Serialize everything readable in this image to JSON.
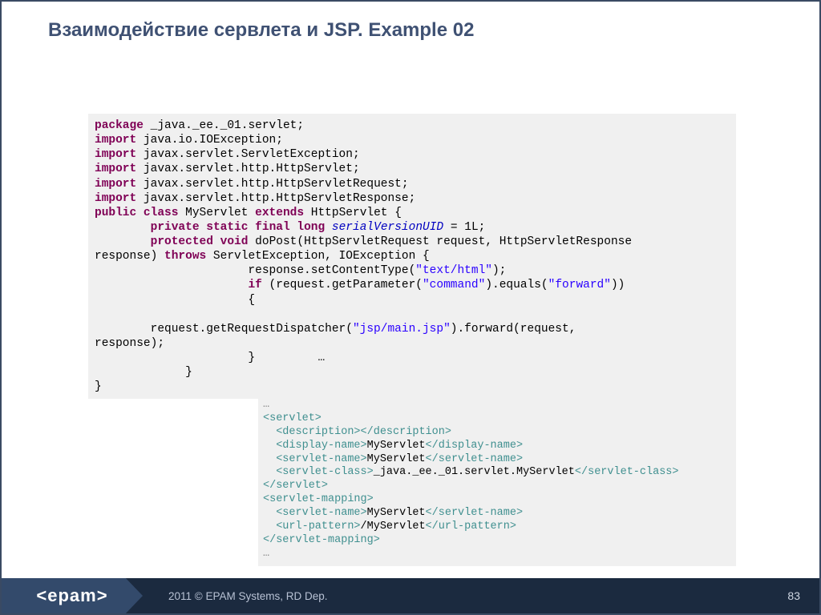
{
  "title": "Взаимодействие сервлета и JSP. Example 02",
  "code1": {
    "l1a": "package",
    "l1b": " _java._ee._01.servlet;",
    "l2a": "import",
    "l2b": " java.io.IOException;",
    "l3a": "import",
    "l3b": " javax.servlet.ServletException;",
    "l4a": "import",
    "l4b": " javax.servlet.http.HttpServlet;",
    "l5a": "import",
    "l5b": " javax.servlet.http.HttpServletRequest;",
    "l6a": "import",
    "l6b": " javax.servlet.http.HttpServletResponse;",
    "l7a": "public",
    "l7b": " class",
    "l7c": " MyServlet ",
    "l7d": "extends",
    "l7e": " HttpServlet {",
    "l8pad": "        ",
    "l8a": "private",
    "l8b": " static",
    "l8c": " final",
    "l8d": " long",
    "l8e": " ",
    "l8f": "serialVersionUID",
    "l8g": " = 1L;",
    "l9pad": "        ",
    "l9a": "protected",
    "l9b": " void",
    "l9c": " doPost(HttpServletRequest request, HttpServletResponse ",
    "l10a": "response) ",
    "l10b": "throws",
    "l10c": " ServletException, IOException {",
    "l11": "                      response.setContentType(",
    "l11s": "\"text/html\"",
    "l11e": ");",
    "l12": "                      ",
    "l12a": "if",
    "l12b": " (request.getParameter(",
    "l12s1": "\"command\"",
    "l12c": ").equals(",
    "l12s2": "\"forward\"",
    "l12d": "))",
    "l13": "                      {",
    "l14": "        request.getRequestDispatcher(",
    "l14s": "\"jsp/main.jsp\"",
    "l14e": ").forward(request, ",
    "l15": "response);",
    "l16": "                      }         …",
    "l17": "             }",
    "l18": "}"
  },
  "code2": {
    "ell1": "…",
    "t1": "<servlet>",
    "t2a": "<description>",
    "t2b": "</description>",
    "t3a": "<display-name>",
    "t3v": "MyServlet",
    "t3b": "</display-name>",
    "t4a": "<servlet-name>",
    "t4v": "MyServlet",
    "t4b": "</servlet-name>",
    "t5a": "<servlet-class>",
    "t5v": "_java._ee._01.servlet.MyServlet",
    "t5b": "</servlet-class>",
    "t6": "</servlet>",
    "t7": "<servlet-mapping>",
    "t8a": "<servlet-name>",
    "t8v": "MyServlet",
    "t8b": "</servlet-name>",
    "t9a": "<url-pattern>",
    "t9v": "/MyServlet",
    "t9b": "</url-pattern>",
    "t10": "</servlet-mapping>",
    "ell2": "…"
  },
  "footer": {
    "logo": "<epam>",
    "copyright": "2011 © EPAM Systems, RD Dep.",
    "page": "83"
  }
}
